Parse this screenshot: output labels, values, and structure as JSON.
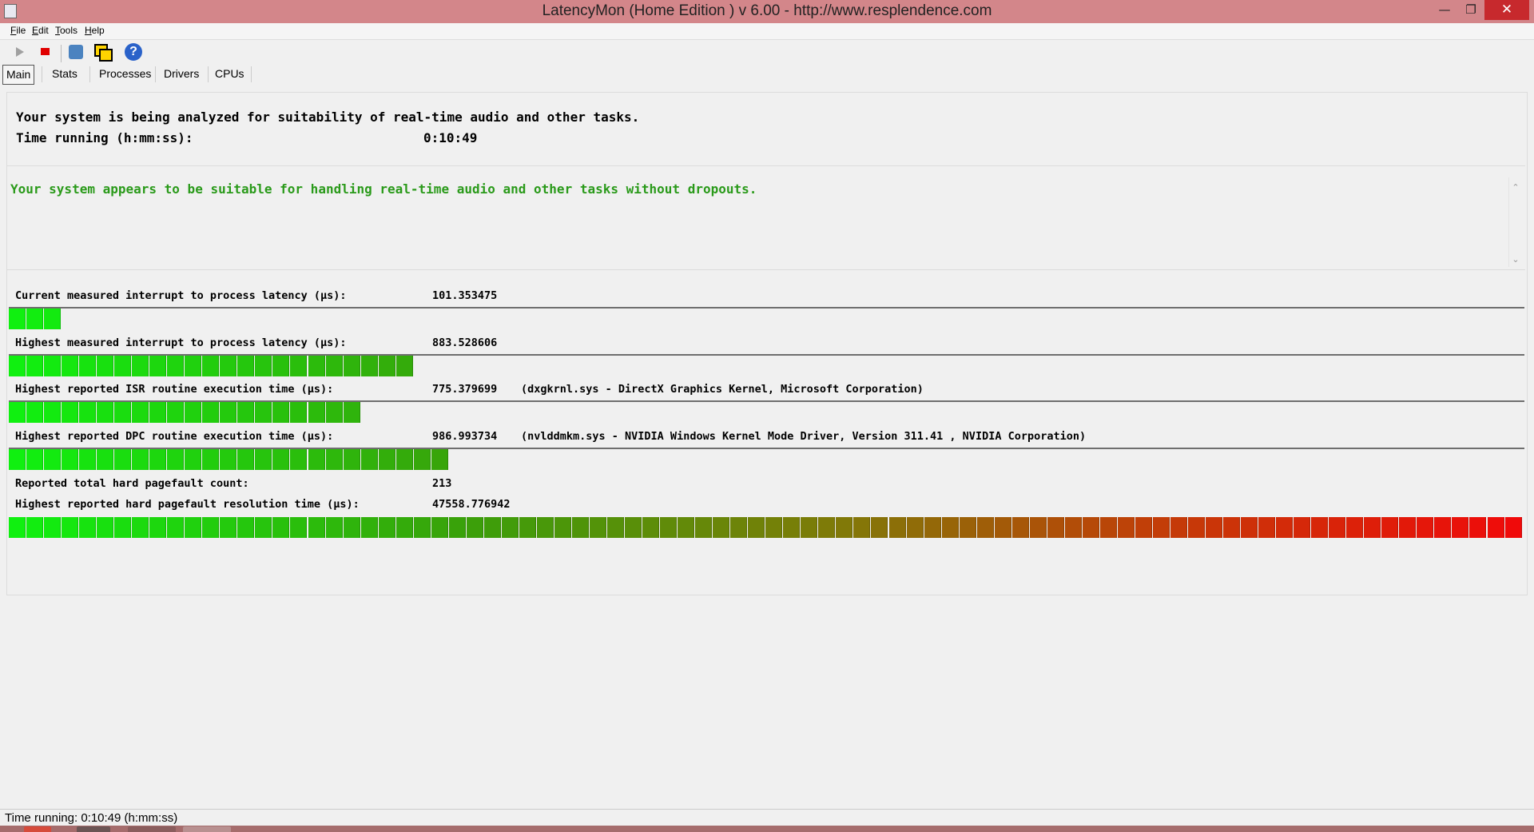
{
  "window": {
    "title": "LatencyMon  (Home Edition )  v 6.00 - http://www.resplendence.com",
    "minimize_glyph": "—",
    "maximize_glyph": "❐",
    "close_glyph": "✕"
  },
  "menu": {
    "items": [
      {
        "hotkey": "F",
        "rest": "ile"
      },
      {
        "hotkey": "E",
        "rest": "dit"
      },
      {
        "hotkey": "T",
        "rest": "ools"
      },
      {
        "hotkey": "H",
        "rest": "elp"
      }
    ]
  },
  "toolbar": {
    "icons": [
      "play-icon",
      "stop-icon",
      "tools-icon",
      "windows-icon",
      "help-icon"
    ]
  },
  "tabs": [
    {
      "label": "Main",
      "active": true
    },
    {
      "label": "Stats",
      "active": false
    },
    {
      "label": "Processes",
      "active": false
    },
    {
      "label": "Drivers",
      "active": false
    },
    {
      "label": "CPUs",
      "active": false
    }
  ],
  "main": {
    "intro_line": "Your system is being analyzed for suitability of real-time audio and other tasks.",
    "time_running_label": "Time running (h:mm:ss):",
    "time_running_value": "0:10:49",
    "verdict": "Your system appears to be suitable for handling real-time audio and other tasks without dropouts.",
    "verdict_color": "#2a9a1a",
    "metrics": [
      {
        "label": "Current measured interrupt to process latency (µs):",
        "value": "101.353475",
        "detail": "",
        "bar_segments": 3
      },
      {
        "label": "Highest measured interrupt to process latency (µs):",
        "value": "883.528606",
        "detail": "",
        "bar_segments": 23
      },
      {
        "label": "Highest reported ISR routine execution time (µs):",
        "value": "775.379699",
        "detail": "(dxgkrnl.sys - DirectX Graphics Kernel, Microsoft Corporation)",
        "bar_segments": 20
      },
      {
        "label": "Highest reported DPC routine execution time (µs):",
        "value": "986.993734",
        "detail": "(nvlddmkm.sys - NVIDIA Windows Kernel Mode Driver, Version 311.41 , NVIDIA Corporation)",
        "bar_segments": 25
      }
    ],
    "pagefault_count_label": "Reported total hard pagefault count:",
    "pagefault_count_value": "213",
    "pagefault_time_label": "Highest reported hard pagefault resolution time (µs):",
    "pagefault_time_value": "47558.776942",
    "pagefault_bar_segments": 86
  },
  "status": {
    "text": "Time running: 0:10:49  (h:mm:ss)"
  }
}
